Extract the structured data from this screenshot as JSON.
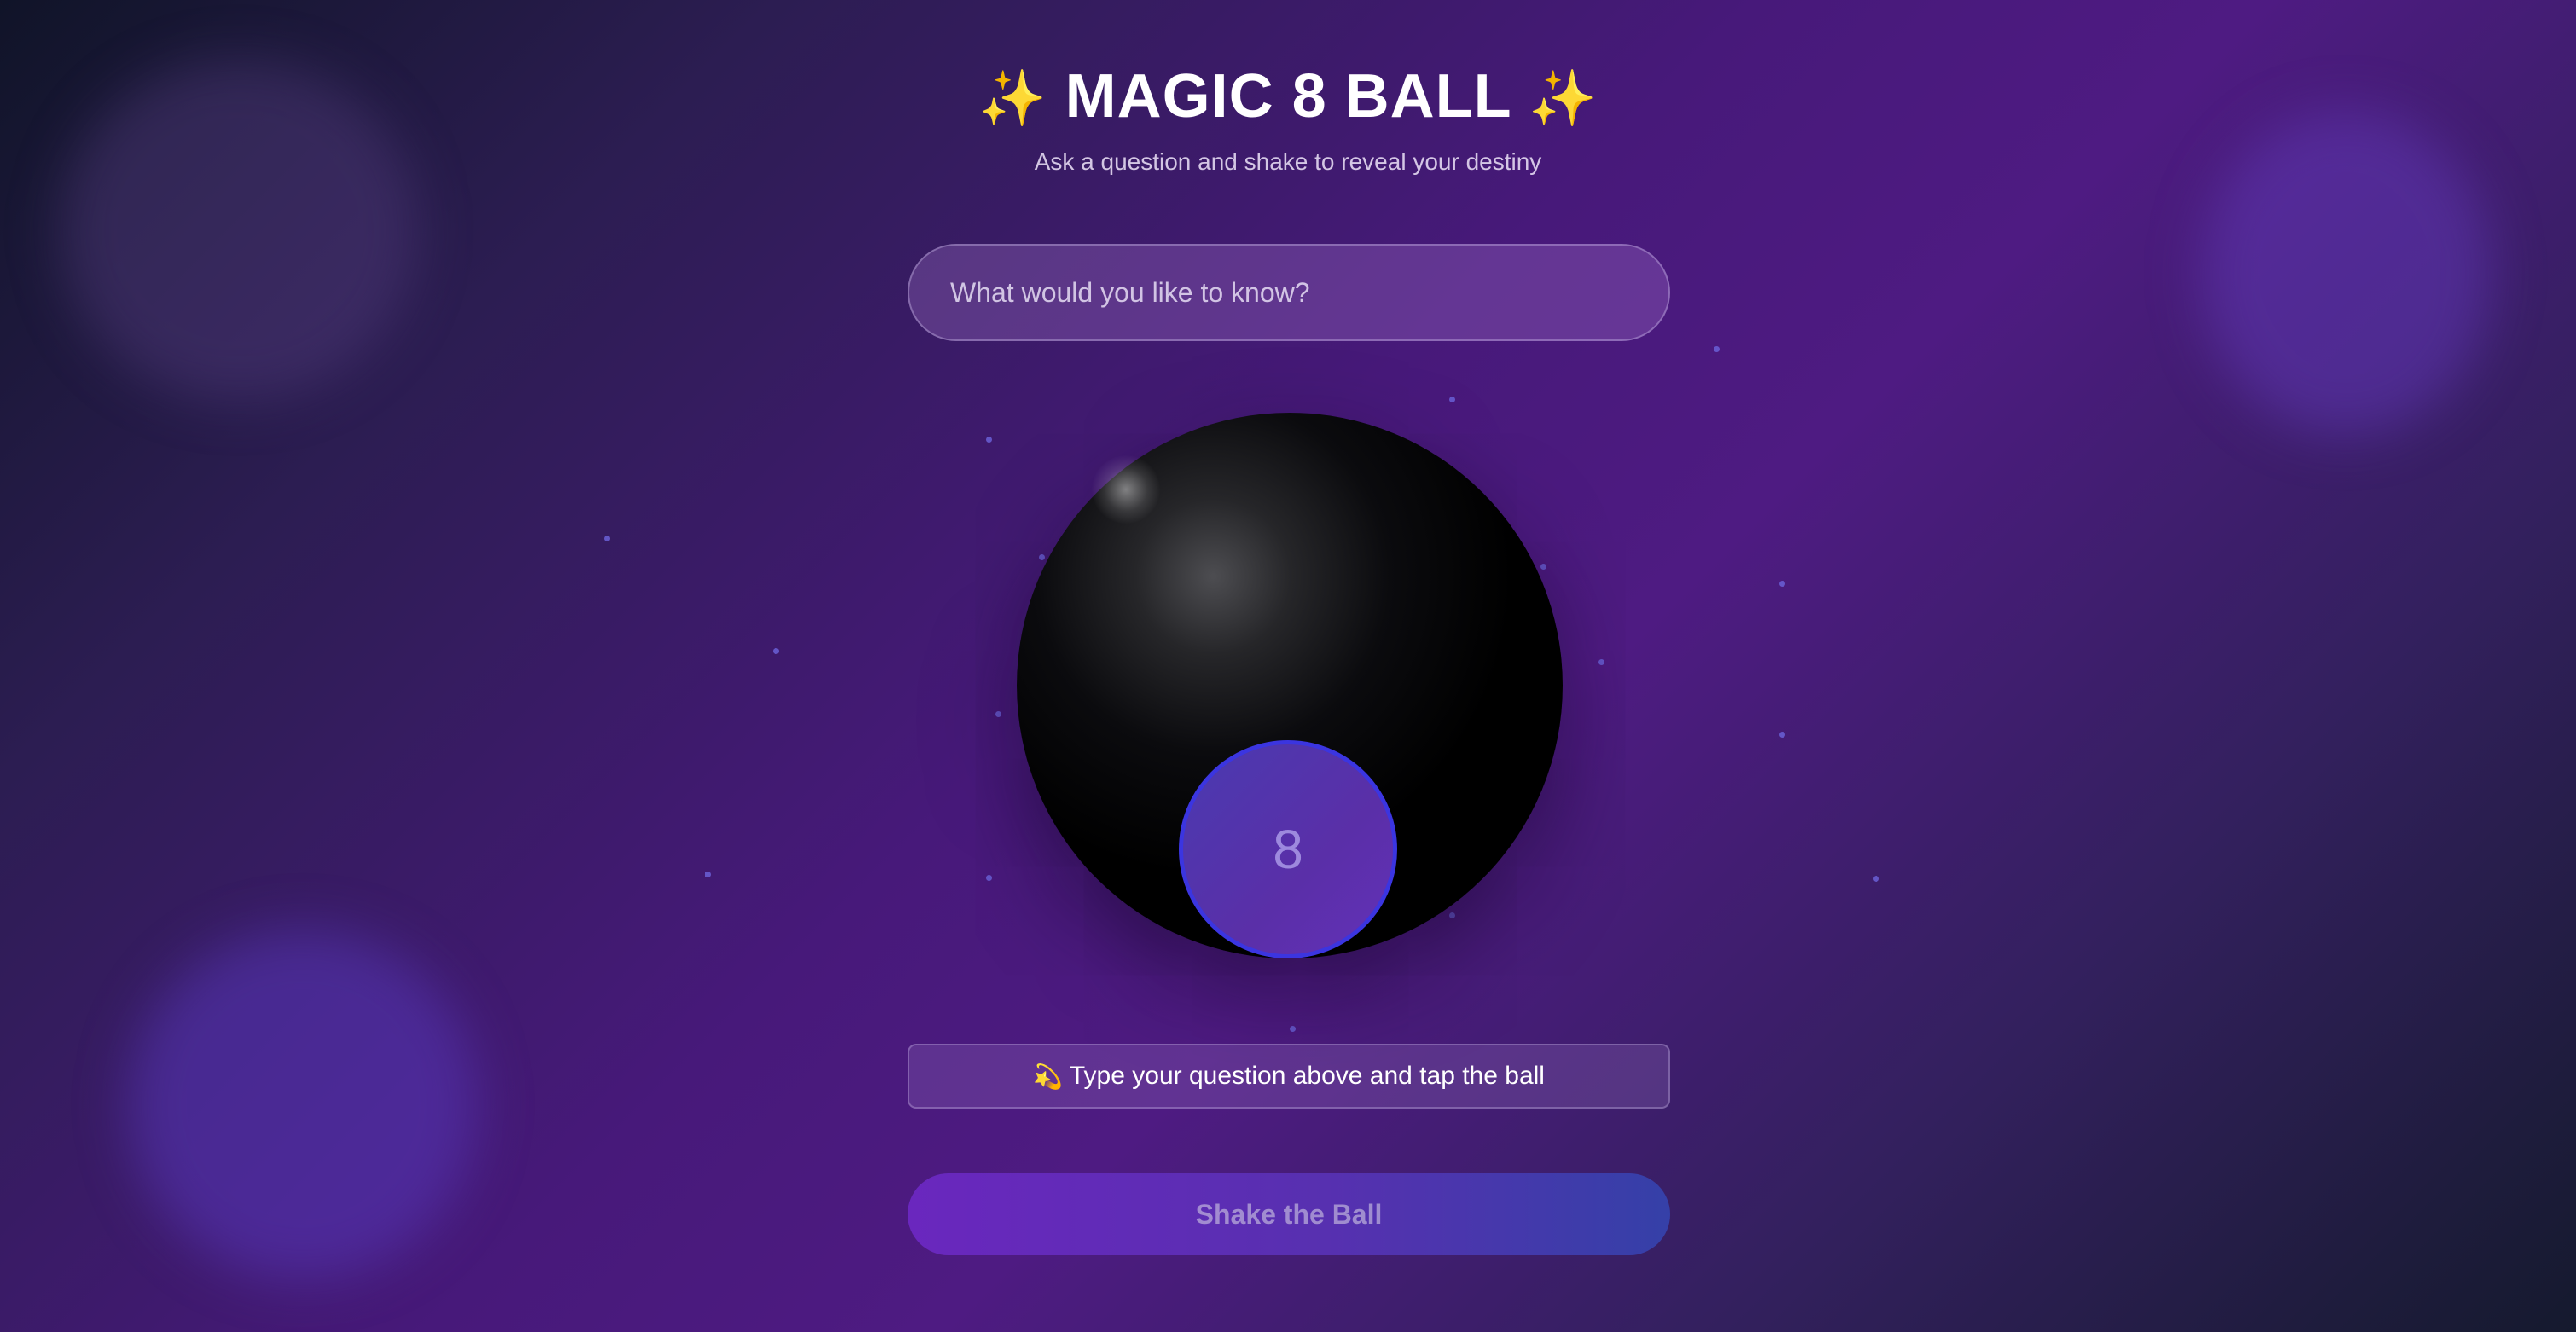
{
  "header": {
    "title": "MAGIC 8 BALL",
    "sparkle_left": "✨",
    "sparkle_right": "✨",
    "subtitle": "Ask a question and shake to reveal your destiny"
  },
  "question": {
    "placeholder": "What would you like to know?",
    "value": ""
  },
  "ball": {
    "number": "8"
  },
  "status": {
    "icon": "💫",
    "text": "Type your question above and tap the ball"
  },
  "shake_button": {
    "label": "Shake the Ball"
  },
  "colors": {
    "accent_gold": "#f7d44c",
    "window_border": "#3b35e0",
    "button_start": "#6a27be",
    "button_end": "#3540a8"
  },
  "icons": {
    "sparkle": "sparkle-icon",
    "status": "dizzy-star-icon"
  }
}
